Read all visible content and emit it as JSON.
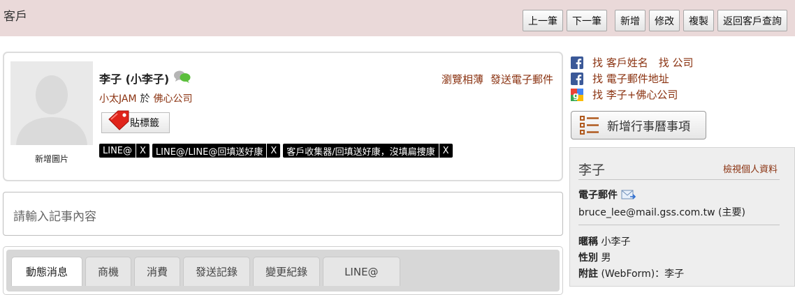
{
  "header": {
    "title": "客戶",
    "buttons": {
      "prev": "上一筆",
      "next": "下一筆",
      "add": "新增",
      "edit": "修改",
      "copy": "複製",
      "back": "返回客戶查詢"
    }
  },
  "contact": {
    "photo_caption": "新增圖片",
    "name": "李子 (小李子)",
    "owner": "小太JAM",
    "at": "於",
    "company": "佛心公司",
    "browse_album": "瀏覽相薄",
    "send_email": "發送電子郵件",
    "tag_button": "貼標籤",
    "tags": [
      {
        "label": "LINE@",
        "remove": "X"
      },
      {
        "label": "LINE@/LINE@回填送好康",
        "remove": "X"
      },
      {
        "label": "客戶收集器/回填送好康，沒填扁捜康",
        "remove": "X"
      }
    ]
  },
  "note": {
    "placeholder": "請輸入記事內容"
  },
  "tabs": [
    "動態消息",
    "商機",
    "消費",
    "發送記錄",
    "變更紀錄",
    "LINE@"
  ],
  "sidebar": {
    "find_rows": [
      {
        "icon": "facebook-icon",
        "links": [
          "找 客戶姓名",
          "找 公司"
        ]
      },
      {
        "icon": "facebook-icon",
        "links": [
          "找 電子郵件地址"
        ]
      },
      {
        "icon": "google-icon",
        "links": [
          "找 李子+佛心公司"
        ]
      }
    ],
    "calendar_button": "新增行事曆事項",
    "profile": {
      "name": "李子",
      "view_profile": "檢視個人資料",
      "email_label": "電子郵件",
      "email": "bruce_lee@mail.gss.com.tw (主要)",
      "nickname_label": "暱稱",
      "nickname": "小李子",
      "gender_label": "性別",
      "gender": "男",
      "remark_label": "附註",
      "remark": "(WebForm)：李子"
    }
  },
  "colors": {
    "header_bg": "#ead9d9",
    "link": "#8a3210",
    "chip_bg": "#000000"
  }
}
